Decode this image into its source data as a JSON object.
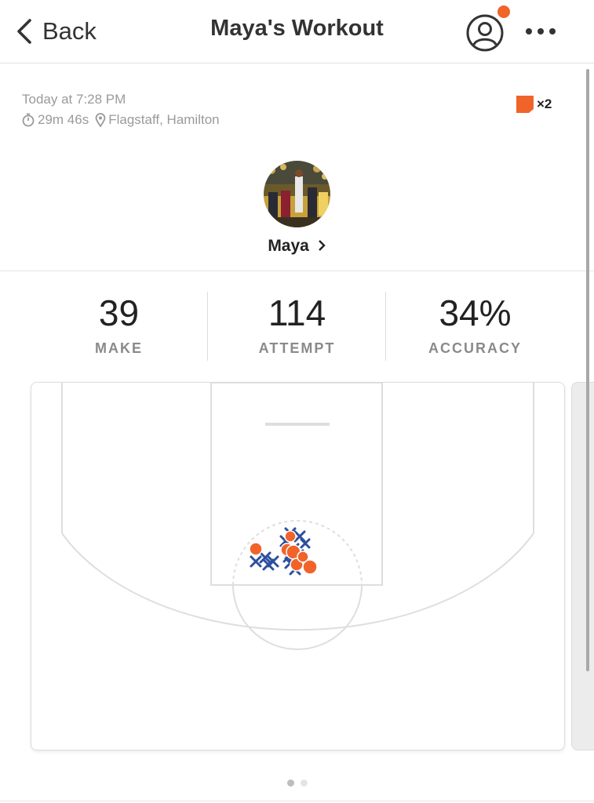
{
  "header": {
    "back_label": "Back",
    "title": "Maya's Workout"
  },
  "session": {
    "date": "Today at 7:28 PM",
    "duration": "29m 46s",
    "location": "Flagstaff, Hamilton",
    "badge_count": "×2"
  },
  "user": {
    "name": "Maya"
  },
  "stats": [
    {
      "value": "39",
      "label": "MAKE"
    },
    {
      "value": "114",
      "label": "ATTEMPT"
    },
    {
      "value": "34%",
      "label": "ACCURACY"
    }
  ],
  "colors": {
    "accent": "#f0642a",
    "miss": "#2b4fa0",
    "court_lines": "#dedede"
  },
  "icons": {
    "back": "chevron-left-icon",
    "profile": "user-circle-icon",
    "more": "more-horizontal-icon",
    "timer": "stopwatch-icon",
    "location": "map-pin-icon",
    "badge": "flag-badge-icon"
  },
  "pager": {
    "pages": 2,
    "active": 0
  }
}
